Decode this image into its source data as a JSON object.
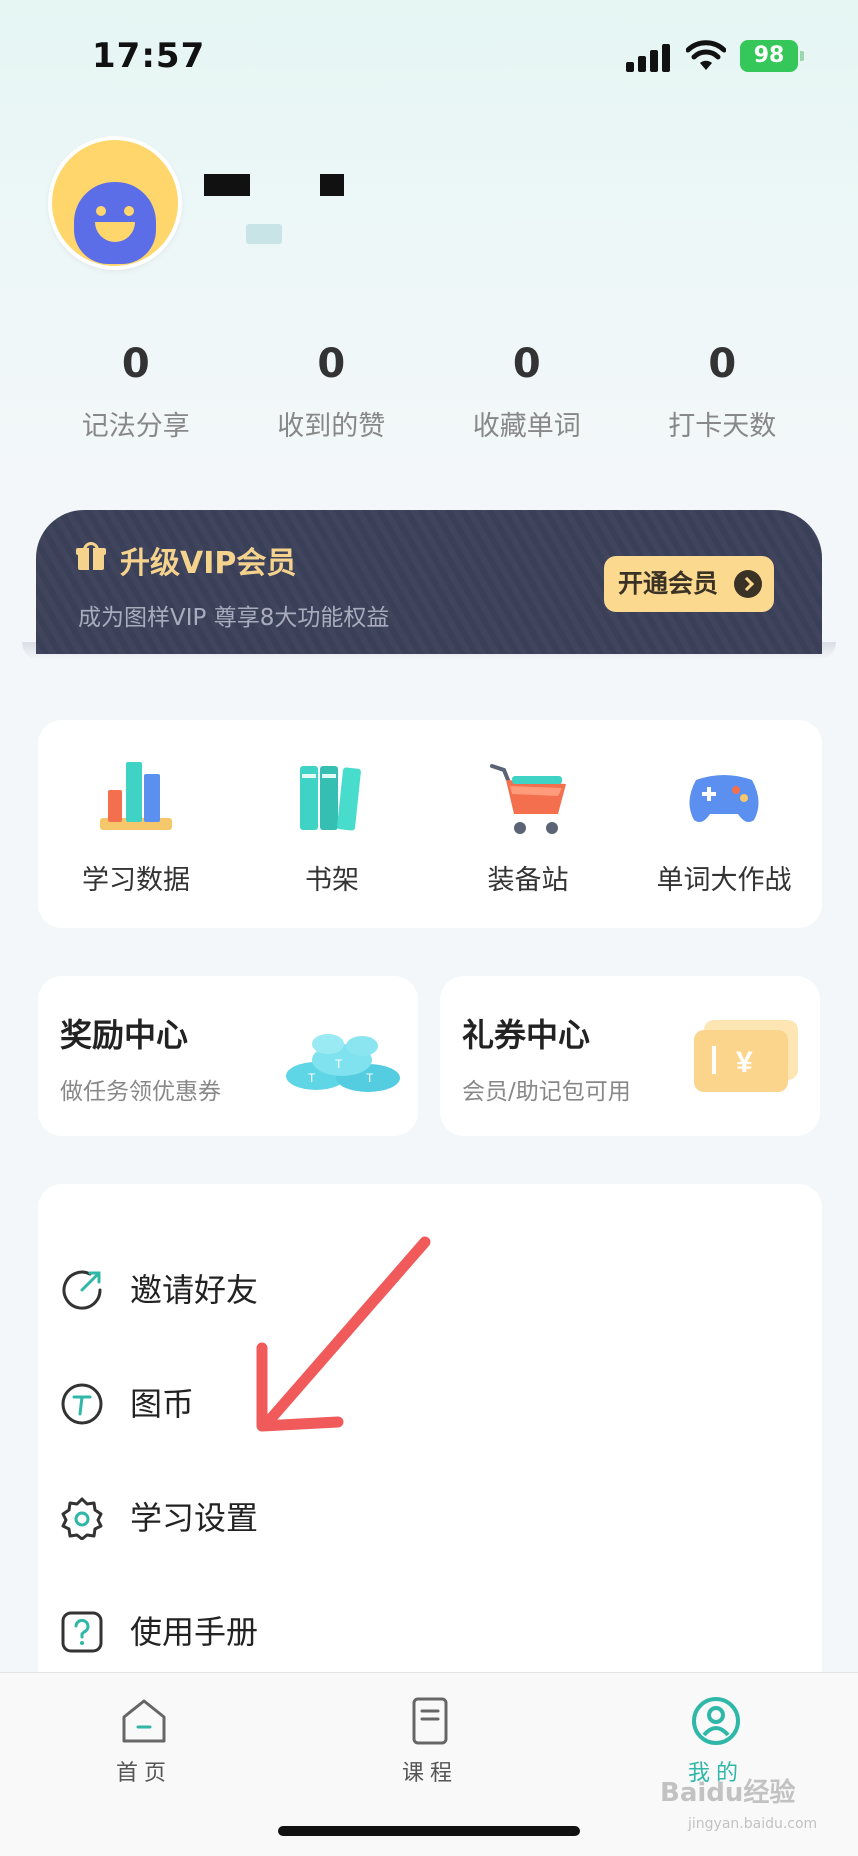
{
  "status_bar": {
    "time": "17:57",
    "battery": "98"
  },
  "stats": [
    {
      "value": "0",
      "label": "记法分享"
    },
    {
      "value": "0",
      "label": "收到的赞"
    },
    {
      "value": "0",
      "label": "收藏单词"
    },
    {
      "value": "0",
      "label": "打卡天数"
    }
  ],
  "vip": {
    "title": "升级VIP会员",
    "subtitle": "成为图样VIP  尊享8大功能权益",
    "button": "开通会员"
  },
  "quick_links": [
    {
      "label": "学习数据",
      "icon": "bar-chart-icon"
    },
    {
      "label": "书架",
      "icon": "bookshelf-icon"
    },
    {
      "label": "装备站",
      "icon": "shopping-cart-icon"
    },
    {
      "label": "单词大作战",
      "icon": "gamepad-icon"
    }
  ],
  "cards": [
    {
      "title": "奖励中心",
      "subtitle": "做任务领优惠券",
      "icon": "coins-icon"
    },
    {
      "title": "礼券中心",
      "subtitle": "会员/助记包可用",
      "icon": "coupon-icon"
    }
  ],
  "menu": [
    {
      "label": "邀请好友",
      "icon": "share-icon"
    },
    {
      "label": "图币",
      "icon": "coin-icon"
    },
    {
      "label": "学习设置",
      "icon": "gear-icon"
    },
    {
      "label": "使用手册",
      "icon": "help-icon"
    }
  ],
  "tabs": [
    {
      "label": "首页",
      "icon": "home-icon",
      "active": false
    },
    {
      "label": "课程",
      "icon": "book-icon",
      "active": false
    },
    {
      "label": "我的",
      "icon": "profile-icon",
      "active": true
    }
  ],
  "watermark": {
    "main": "Baidu经验",
    "sub": "jingyan.baidu.com"
  },
  "colors": {
    "accent": "#2fb8a8",
    "vip_bg": "#3b4059",
    "vip_gold": "#f5d38d",
    "annotation": "#f05a5a"
  }
}
